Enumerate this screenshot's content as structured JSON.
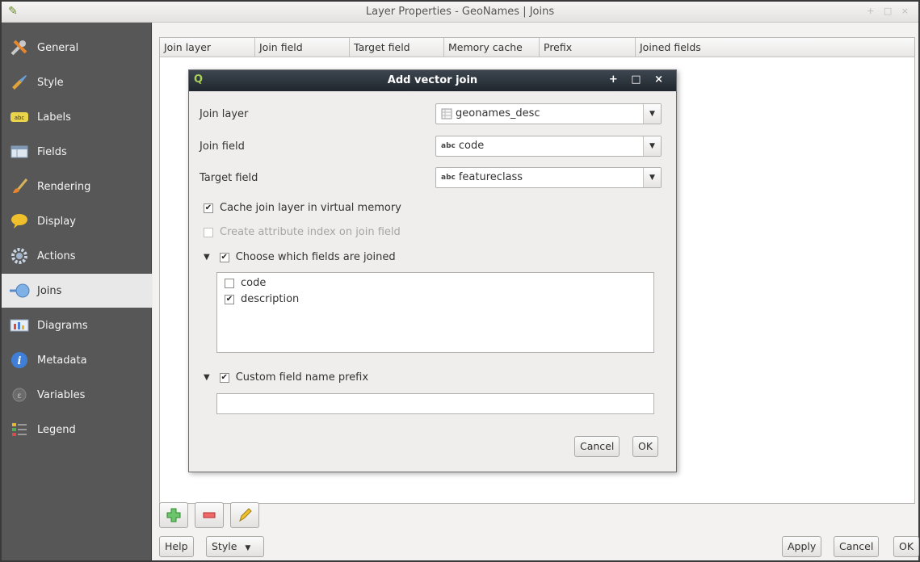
{
  "window": {
    "title": "Layer Properties - GeoNames | Joins",
    "controls": "+ □ ×"
  },
  "sidebar": {
    "items": [
      {
        "label": "General",
        "icon": "wrench-screwdriver-icon"
      },
      {
        "label": "Style",
        "icon": "paint-brush-icon"
      },
      {
        "label": "Labels",
        "icon": "abc-label-icon"
      },
      {
        "label": "Fields",
        "icon": "table-fields-icon"
      },
      {
        "label": "Rendering",
        "icon": "brush-icon"
      },
      {
        "label": "Display",
        "icon": "speech-bubble-icon"
      },
      {
        "label": "Actions",
        "icon": "gear-icon"
      },
      {
        "label": "Joins",
        "icon": "join-icon"
      },
      {
        "label": "Diagrams",
        "icon": "bar-chart-icon"
      },
      {
        "label": "Metadata",
        "icon": "info-icon"
      },
      {
        "label": "Variables",
        "icon": "variables-icon"
      },
      {
        "label": "Legend",
        "icon": "legend-icon"
      }
    ],
    "active": "Joins"
  },
  "joins_table": {
    "columns": [
      "Join layer",
      "Join field",
      "Target field",
      "Memory cache",
      "Prefix",
      "Joined fields"
    ]
  },
  "dialog": {
    "title": "Add vector join",
    "controls": "+ □ ×",
    "join_layer_label": "Join layer",
    "join_layer_value": "geonames_desc",
    "join_field_label": "Join field",
    "join_field_value": "code",
    "target_field_label": "Target field",
    "target_field_value": "featureclass",
    "abc_prefix": "abc",
    "cache_label": "Cache join layer in virtual memory",
    "cache_checked": true,
    "index_label": "Create attribute index on join field",
    "index_checked": false,
    "choose_fields_label": "Choose which fields are joined",
    "choose_fields_checked": true,
    "fields": [
      {
        "name": "code",
        "checked": false
      },
      {
        "name": "description",
        "checked": true
      }
    ],
    "custom_prefix_label": "Custom field name prefix",
    "custom_prefix_checked": true,
    "custom_prefix_value": "",
    "cancel_label": "Cancel",
    "ok_label": "OK"
  },
  "bottom": {
    "help_label": "Help",
    "style_label": "Style",
    "apply_label": "Apply",
    "cancel_label": "Cancel",
    "ok_label": "OK"
  },
  "colors": {
    "sidebar_bg": "#575757",
    "dialog_title_bg": "#1f262d",
    "add_button": "#4caf50",
    "remove_button": "#e53935",
    "edit_button": "#e0b93c"
  }
}
